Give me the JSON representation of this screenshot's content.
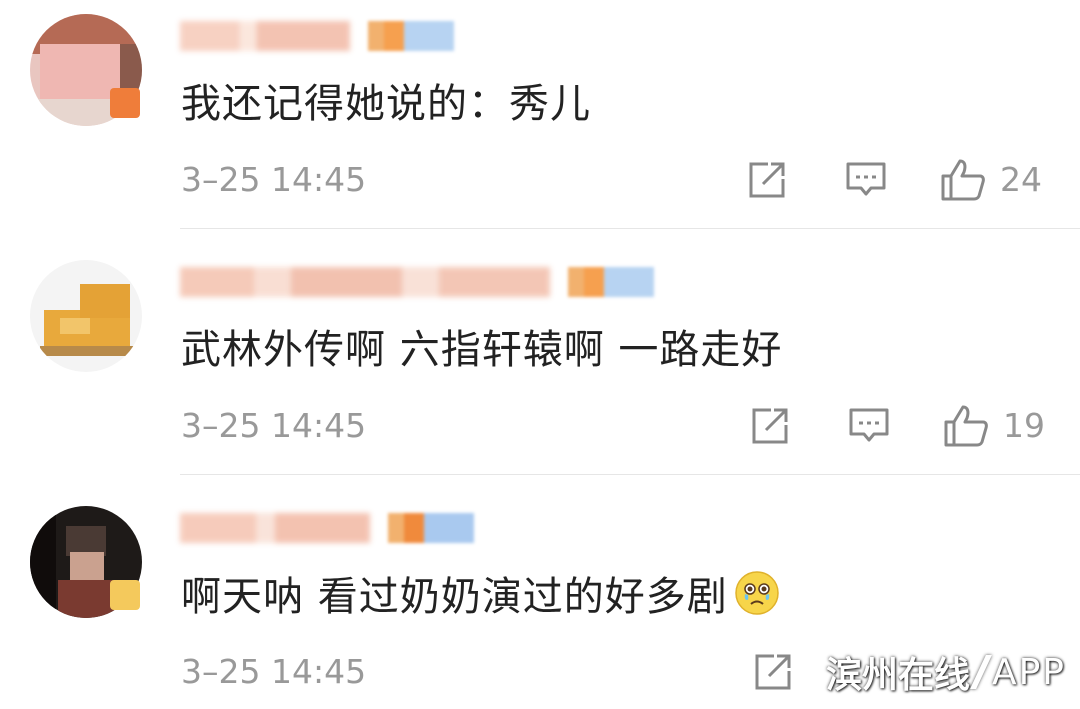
{
  "comments": [
    {
      "text": "我还记得她说的：秀儿",
      "time": "3–25 14:45",
      "likes": "24"
    },
    {
      "text": "武林外传啊 六指轩辕啊 一路走好",
      "time": "3–25 14:45",
      "likes": "19"
    },
    {
      "text": "啊天呐 看过奶奶演过的好多剧",
      "time": "3–25 14:45",
      "likes": ""
    }
  ],
  "icons": {
    "share": "share-icon",
    "comment": "comment-icon",
    "like": "thumbs-up-icon",
    "emoji": "crying-face-emoji"
  },
  "watermark": {
    "name": "滨州在线",
    "app": "APP"
  },
  "colors": {
    "text": "#222222",
    "meta": "#999999",
    "divider": "#e6e6e6"
  }
}
